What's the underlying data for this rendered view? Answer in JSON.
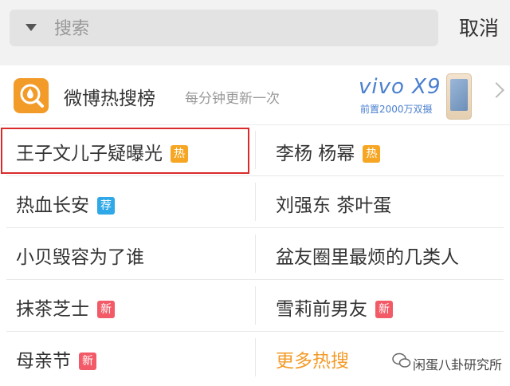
{
  "search": {
    "placeholder": "搜索",
    "cancel_label": "取消"
  },
  "hotboard": {
    "title": "微博热搜榜",
    "subtitle": "每分钟更新一次",
    "logo_icon": "hot-search-flame-icon",
    "ad": {
      "brand": "vivo X9",
      "caption": "前置2000万双摄"
    }
  },
  "topics": [
    {
      "left": {
        "text": "王子文儿子疑曝光",
        "badge": "热",
        "badge_type": "hot",
        "highlighted": true
      },
      "right": {
        "text": "李杨 杨幂",
        "badge": "热",
        "badge_type": "hot"
      }
    },
    {
      "left": {
        "text": "热血长安",
        "badge": "荐",
        "badge_type": "rec"
      },
      "right": {
        "text": "刘强东 茶叶蛋",
        "badge": ""
      }
    },
    {
      "left": {
        "text": "小贝毁容为了谁",
        "badge": ""
      },
      "right": {
        "text": "盆友圈里最烦的几类人",
        "badge": ""
      }
    },
    {
      "left": {
        "text": "抹茶芝士",
        "badge": "新",
        "badge_type": "new"
      },
      "right": {
        "text": "雪莉前男友",
        "badge": "新",
        "badge_type": "new"
      }
    },
    {
      "left": {
        "text": "母亲节",
        "badge": "新",
        "badge_type": "new"
      },
      "right": {
        "text": "更多热搜",
        "badge": "",
        "is_more_link": true
      }
    }
  ],
  "watermark": {
    "text": "闲蛋八卦研究所"
  },
  "colors": {
    "accent_orange": "#f39b28",
    "badge_hot": "#f6a623",
    "badge_rec": "#2ea8e6",
    "badge_new": "#f25a67",
    "highlight_red": "#d92b2b"
  }
}
